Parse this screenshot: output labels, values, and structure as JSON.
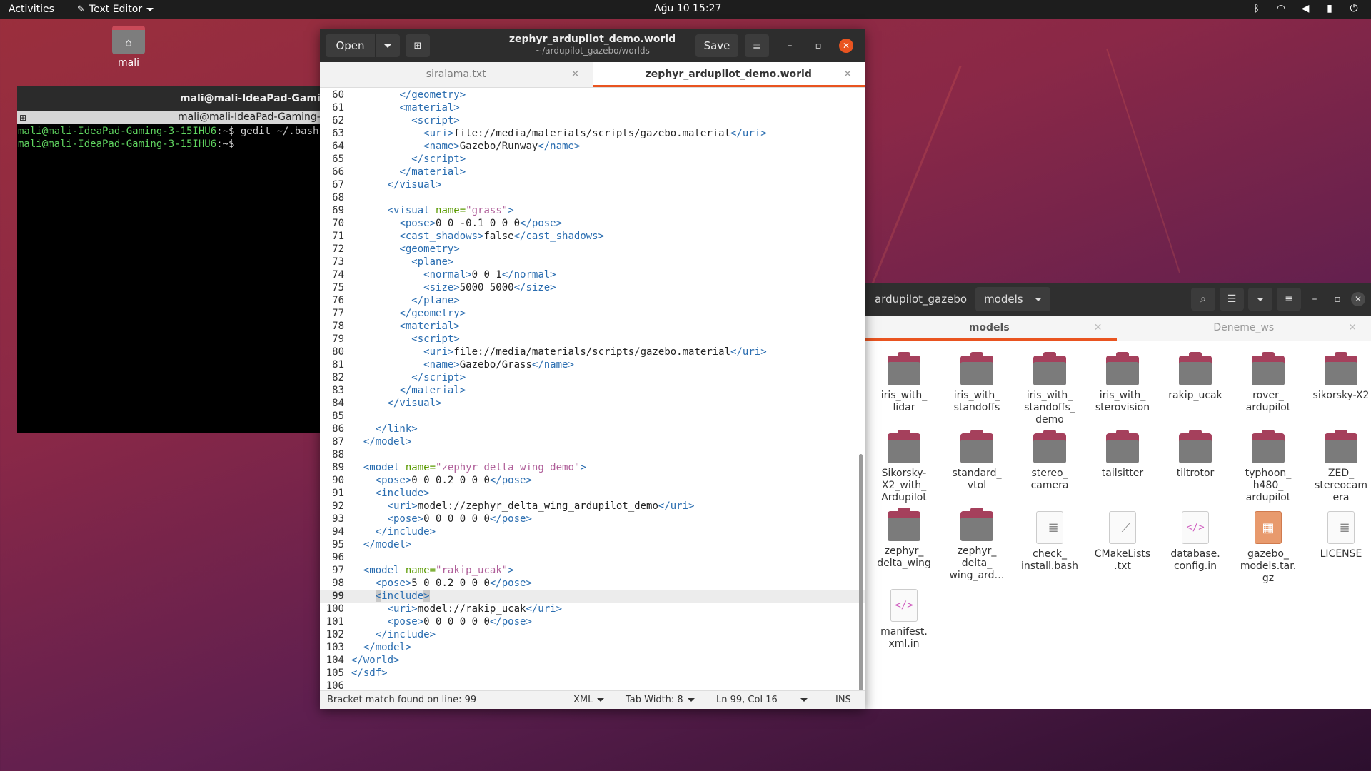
{
  "topbar": {
    "activities": "Activities",
    "app_menu": "Text Editor",
    "clock": "Ağu 10  15:27",
    "tray_icons": [
      "bluetooth-icon",
      "wifi-icon",
      "volume-icon",
      "battery-icon",
      "power-menu-icon"
    ]
  },
  "desktop": {
    "home_label": "mali"
  },
  "terminal": {
    "window_title": "mali@mali-IdeaPad-Gaming-3-15IHU6: ~",
    "tab_title": "mali@mali-IdeaPad-Gaming-3-15IHU6: ~",
    "lines": [
      {
        "user": "mali@mali-IdeaPad-Gaming-3-15IHU6",
        "path": ":~$ ",
        "cmd": "gedit ~/.bashrc"
      },
      {
        "user": "mali@mali-IdeaPad-Gaming-3-15IHU6",
        "path": ":~$ ",
        "cmd": ""
      }
    ]
  },
  "gedit": {
    "open_label": "Open",
    "save_label": "Save",
    "title": "zephyr_ardupilot_demo.world",
    "subtitle": "~/ardupilot_gazebo/worlds",
    "tabs": [
      {
        "label": "siralama.txt",
        "active": false
      },
      {
        "label": "zephyr_ardupilot_demo.world",
        "active": true
      }
    ],
    "current_line": 99,
    "code_lines": [
      {
        "n": 60,
        "html": "        <span class='tg'>&lt;/geometry&gt;</span>"
      },
      {
        "n": 61,
        "html": "        <span class='tg'>&lt;material&gt;</span>"
      },
      {
        "n": 62,
        "html": "          <span class='tg'>&lt;script&gt;</span>"
      },
      {
        "n": 63,
        "html": "            <span class='tg'>&lt;uri&gt;</span>file://media/materials/scripts/gazebo.material<span class='tg'>&lt;/uri&gt;</span>"
      },
      {
        "n": 64,
        "html": "            <span class='tg'>&lt;name&gt;</span>Gazebo/Runway<span class='tg'>&lt;/name&gt;</span>"
      },
      {
        "n": 65,
        "html": "          <span class='tg'>&lt;/script&gt;</span>"
      },
      {
        "n": 66,
        "html": "        <span class='tg'>&lt;/material&gt;</span>"
      },
      {
        "n": 67,
        "html": "      <span class='tg'>&lt;/visual&gt;</span>"
      },
      {
        "n": 68,
        "html": ""
      },
      {
        "n": 69,
        "html": "      <span class='tg'>&lt;visual </span><span class='an'>name=</span><span class='av'>\"grass\"</span><span class='tg'>&gt;</span>"
      },
      {
        "n": 70,
        "html": "        <span class='tg'>&lt;pose&gt;</span>0 0 -0.1 0 0 0<span class='tg'>&lt;/pose&gt;</span>"
      },
      {
        "n": 71,
        "html": "        <span class='tg'>&lt;cast_shadows&gt;</span>false<span class='tg'>&lt;/cast_shadows&gt;</span>"
      },
      {
        "n": 72,
        "html": "        <span class='tg'>&lt;geometry&gt;</span>"
      },
      {
        "n": 73,
        "html": "          <span class='tg'>&lt;plane&gt;</span>"
      },
      {
        "n": 74,
        "html": "            <span class='tg'>&lt;normal&gt;</span>0 0 1<span class='tg'>&lt;/normal&gt;</span>"
      },
      {
        "n": 75,
        "html": "            <span class='tg'>&lt;size&gt;</span>5000 5000<span class='tg'>&lt;/size&gt;</span>"
      },
      {
        "n": 76,
        "html": "          <span class='tg'>&lt;/plane&gt;</span>"
      },
      {
        "n": 77,
        "html": "        <span class='tg'>&lt;/geometry&gt;</span>"
      },
      {
        "n": 78,
        "html": "        <span class='tg'>&lt;material&gt;</span>"
      },
      {
        "n": 79,
        "html": "          <span class='tg'>&lt;script&gt;</span>"
      },
      {
        "n": 80,
        "html": "            <span class='tg'>&lt;uri&gt;</span>file://media/materials/scripts/gazebo.material<span class='tg'>&lt;/uri&gt;</span>"
      },
      {
        "n": 81,
        "html": "            <span class='tg'>&lt;name&gt;</span>Gazebo/Grass<span class='tg'>&lt;/name&gt;</span>"
      },
      {
        "n": 82,
        "html": "          <span class='tg'>&lt;/script&gt;</span>"
      },
      {
        "n": 83,
        "html": "        <span class='tg'>&lt;/material&gt;</span>"
      },
      {
        "n": 84,
        "html": "      <span class='tg'>&lt;/visual&gt;</span>"
      },
      {
        "n": 85,
        "html": ""
      },
      {
        "n": 86,
        "html": "    <span class='tg'>&lt;/link&gt;</span>"
      },
      {
        "n": 87,
        "html": "  <span class='tg'>&lt;/model&gt;</span>"
      },
      {
        "n": 88,
        "html": ""
      },
      {
        "n": 89,
        "html": "  <span class='tg'>&lt;model </span><span class='an'>name=</span><span class='av'>\"zephyr_delta_wing_demo\"</span><span class='tg'>&gt;</span>"
      },
      {
        "n": 90,
        "html": "    <span class='tg'>&lt;pose&gt;</span>0 0 0.2 0 0 0<span class='tg'>&lt;/pose&gt;</span>"
      },
      {
        "n": 91,
        "html": "    <span class='tg'>&lt;include&gt;</span>"
      },
      {
        "n": 92,
        "html": "      <span class='tg'>&lt;uri&gt;</span>model://zephyr_delta_wing_ardupilot_demo<span class='tg'>&lt;/uri&gt;</span>"
      },
      {
        "n": 93,
        "html": "      <span class='tg'>&lt;pose&gt;</span>0 0 0 0 0 0<span class='tg'>&lt;/pose&gt;</span>"
      },
      {
        "n": 94,
        "html": "    <span class='tg'>&lt;/include&gt;</span>"
      },
      {
        "n": 95,
        "html": "  <span class='tg'>&lt;/model&gt;</span>"
      },
      {
        "n": 96,
        "html": ""
      },
      {
        "n": 97,
        "html": "  <span class='tg'>&lt;model </span><span class='an'>name=</span><span class='av'>\"rakip_ucak\"</span><span class='tg'>&gt;</span>"
      },
      {
        "n": 98,
        "html": "    <span class='tg'>&lt;pose&gt;</span>5 0 0.2 0 0 0<span class='tg'>&lt;/pose&gt;</span>"
      },
      {
        "n": 99,
        "html": "    <span class='tg'><span class='bm'>&lt;</span>include<span class='bm'>&gt;</span></span>"
      },
      {
        "n": 100,
        "html": "      <span class='tg'>&lt;uri&gt;</span>model://rakip_ucak<span class='tg'>&lt;/uri&gt;</span>"
      },
      {
        "n": 101,
        "html": "      <span class='tg'>&lt;pose&gt;</span>0 0 0 0 0 0<span class='tg'>&lt;/pose&gt;</span>"
      },
      {
        "n": 102,
        "html": "    <span class='tg'>&lt;/include&gt;</span>"
      },
      {
        "n": 103,
        "html": "  <span class='tg'>&lt;/model&gt;</span>"
      },
      {
        "n": 104,
        "html": "<span class='tg'>&lt;/world&gt;</span>"
      },
      {
        "n": 105,
        "html": "<span class='tg'>&lt;/sdf&gt;</span>"
      },
      {
        "n": 106,
        "html": ""
      }
    ],
    "status": {
      "message": "Bracket match found on line: 99",
      "language": "XML",
      "tab_width": "Tab Width: 8",
      "position": "Ln 99, Col 16",
      "mode": "INS"
    }
  },
  "files": {
    "breadcrumbs": [
      "ardupilot_gazebo",
      "models"
    ],
    "tabs": [
      {
        "label": "models",
        "active": true
      },
      {
        "label": "Deneme_ws",
        "active": false
      }
    ],
    "items": [
      {
        "label": "iris_with_\nlidar",
        "kind": "folder"
      },
      {
        "label": "iris_with_\nstandoffs",
        "kind": "folder"
      },
      {
        "label": "iris_with_\nstandoffs_\ndemo",
        "kind": "folder"
      },
      {
        "label": "iris_with_\nsterovision",
        "kind": "folder"
      },
      {
        "label": "rakip_ucak",
        "kind": "folder"
      },
      {
        "label": "rover_\nardupilot",
        "kind": "folder"
      },
      {
        "label": "sikorsky-X2",
        "kind": "folder"
      },
      {
        "label": "Sikorsky-\nX2_with_\nArdupilot",
        "kind": "folder"
      },
      {
        "label": "standard_\nvtol",
        "kind": "folder"
      },
      {
        "label": "stereo_\ncamera",
        "kind": "folder"
      },
      {
        "label": "tailsitter",
        "kind": "folder"
      },
      {
        "label": "tiltrotor",
        "kind": "folder"
      },
      {
        "label": "typhoon_\nh480_\nardupilot",
        "kind": "folder"
      },
      {
        "label": "ZED_\nstereocam\nera",
        "kind": "folder"
      },
      {
        "label": "zephyr_\ndelta_wing",
        "kind": "folder"
      },
      {
        "label": "zephyr_\ndelta_\nwing_ard…",
        "kind": "folder"
      },
      {
        "label": "check_\ninstall.bash",
        "kind": "text"
      },
      {
        "label": "CMakeLists\n.txt",
        "kind": "cmake"
      },
      {
        "label": "database.\nconfig.in",
        "kind": "code"
      },
      {
        "label": "gazebo_\nmodels.tar.\ngz",
        "kind": "archive"
      },
      {
        "label": "LICENSE",
        "kind": "text"
      },
      {
        "label": "manifest.\nxml.in",
        "kind": "code"
      }
    ]
  },
  "colors": {
    "accent": "#e95420",
    "folder_tab": "#a5405c",
    "folder_body": "#7b7b7b"
  }
}
